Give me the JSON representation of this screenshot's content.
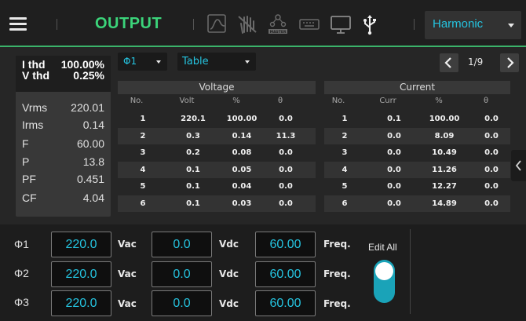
{
  "header": {
    "title": "OUTPUT",
    "harmonic_select": "Harmonic",
    "accent_color": "#3bd47a",
    "icons": [
      "menu-icon",
      "waveform-icon",
      "no-touch-icon",
      "master-icon",
      "keyboard-icon",
      "monitor-icon",
      "usb-icon"
    ],
    "master_label": "MASTER"
  },
  "measurements": {
    "vthd": {
      "label": "V thd",
      "value": "0.25%"
    },
    "ithd": {
      "label": "I thd",
      "value": "100.00%"
    },
    "rows": [
      {
        "label": "Vrms",
        "value": "220.01"
      },
      {
        "label": "Irms",
        "value": "0.14"
      },
      {
        "label": "F",
        "value": "60.00"
      },
      {
        "label": "P",
        "value": "13.8"
      },
      {
        "label": "PF",
        "value": "0.451"
      },
      {
        "label": "CF",
        "value": "4.04"
      }
    ]
  },
  "controls": {
    "phase": "Φ1",
    "view": "Table",
    "page": "1/9"
  },
  "voltage_table": {
    "title": "Voltage",
    "headers": [
      "No.",
      "Volt",
      "%",
      "θ"
    ],
    "rows": [
      [
        "1",
        "220.1",
        "100.00",
        "0.0"
      ],
      [
        "2",
        "0.3",
        "0.14",
        "11.3"
      ],
      [
        "3",
        "0.2",
        "0.08",
        "0.0"
      ],
      [
        "4",
        "0.1",
        "0.05",
        "0.0"
      ],
      [
        "5",
        "0.1",
        "0.04",
        "0.0"
      ],
      [
        "6",
        "0.1",
        "0.03",
        "0.0"
      ]
    ]
  },
  "current_table": {
    "title": "Current",
    "headers": [
      "No.",
      "Curr",
      "%",
      "θ"
    ],
    "rows": [
      [
        "1",
        "0.1",
        "100.00",
        "0.0"
      ],
      [
        "2",
        "0.0",
        "8.09",
        "0.0"
      ],
      [
        "3",
        "0.0",
        "10.49",
        "0.0"
      ],
      [
        "4",
        "0.0",
        "11.26",
        "0.0"
      ],
      [
        "5",
        "0.0",
        "12.27",
        "0.0"
      ],
      [
        "6",
        "0.0",
        "14.89",
        "0.0"
      ]
    ]
  },
  "settings": {
    "edit_all_label": "Edit All",
    "edit_all_on": true,
    "phases": [
      {
        "label": "Φ1",
        "vac": "220.0",
        "vac_unit": "Vac",
        "vdc": "0.0",
        "vdc_unit": "Vdc",
        "freq": "60.00",
        "freq_unit": "Freq."
      },
      {
        "label": "Φ2",
        "vac": "220.0",
        "vac_unit": "Vac",
        "vdc": "0.0",
        "vdc_unit": "Vdc",
        "freq": "60.00",
        "freq_unit": "Freq."
      },
      {
        "label": "Φ3",
        "vac": "220.0",
        "vac_unit": "Vac",
        "vdc": "0.0",
        "vdc_unit": "Vdc",
        "freq": "60.00",
        "freq_unit": "Freq."
      }
    ]
  }
}
